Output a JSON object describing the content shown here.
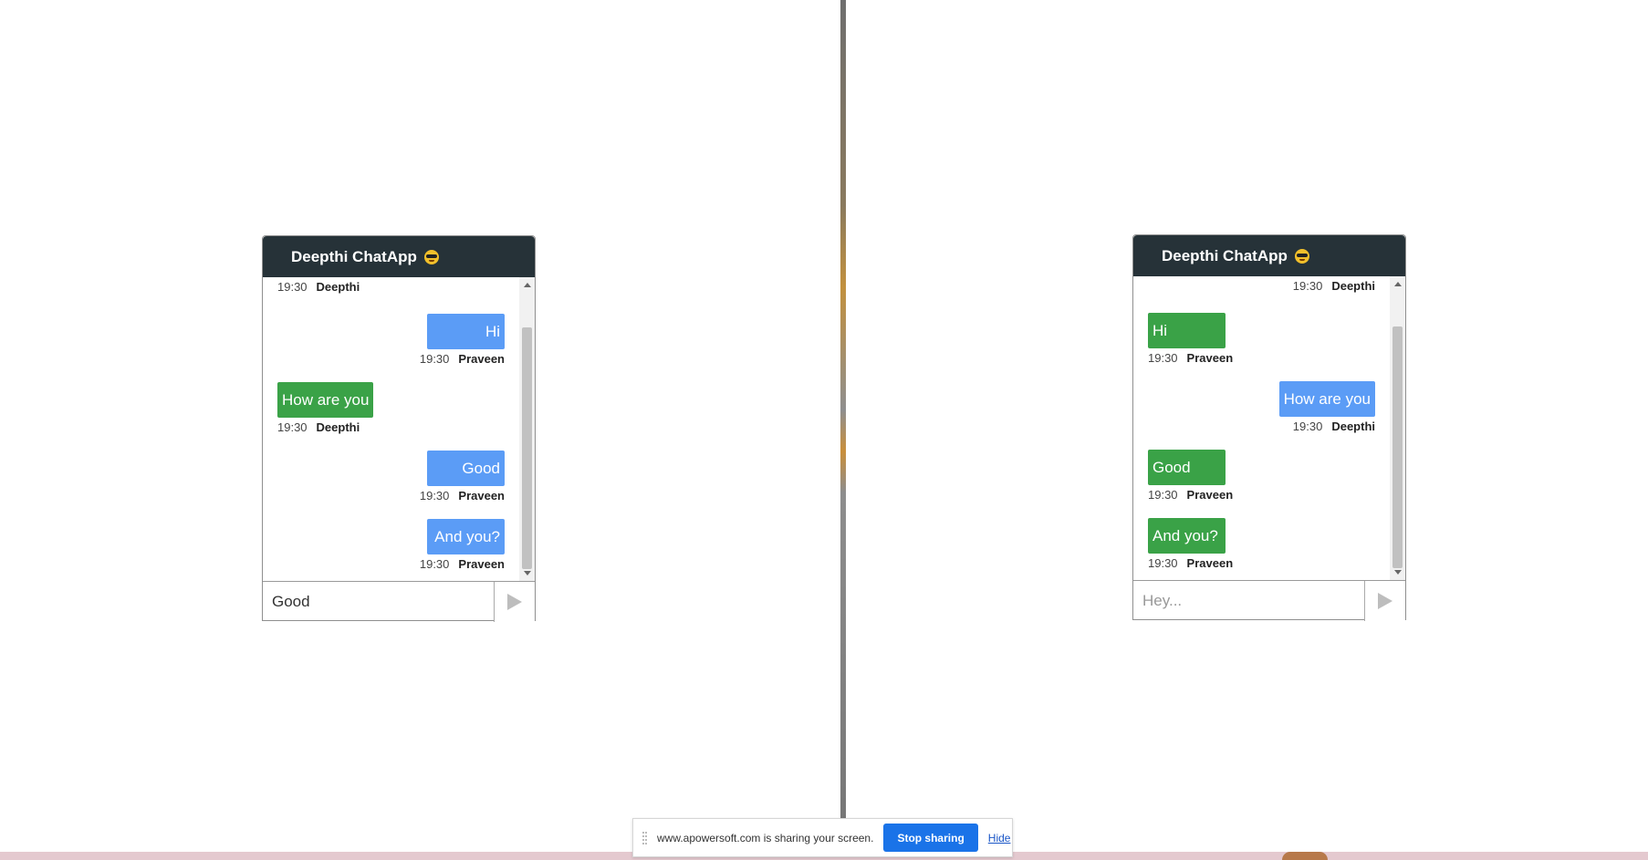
{
  "share_bar": {
    "message": "www.apowersoft.com is sharing your screen.",
    "stop_label": "Stop sharing",
    "hide_label": "Hide"
  },
  "chat_left": {
    "title": "Deepthi ChatApp",
    "input_value": "Good",
    "input_placeholder": "Hey...",
    "top_meta": {
      "time": "19:30",
      "name": "Deepthi"
    },
    "messages": [
      {
        "text": "Hi",
        "time": "19:30",
        "name": "Praveen",
        "side": "right",
        "color": "blue"
      },
      {
        "text": "How are you",
        "time": "19:30",
        "name": "Deepthi",
        "side": "left",
        "color": "green"
      },
      {
        "text": "Good",
        "time": "19:30",
        "name": "Praveen",
        "side": "right",
        "color": "blue"
      },
      {
        "text": "And you?",
        "time": "19:30",
        "name": "Praveen",
        "side": "right",
        "color": "blue"
      }
    ]
  },
  "chat_right": {
    "title": "Deepthi ChatApp",
    "input_value": "",
    "input_placeholder": "Hey...",
    "top_meta": {
      "time": "19:30",
      "name": "Deepthi"
    },
    "messages": [
      {
        "text": "Hi",
        "time": "19:30",
        "name": "Praveen",
        "side": "left",
        "color": "green"
      },
      {
        "text": "How are you",
        "time": "19:30",
        "name": "Deepthi",
        "side": "right",
        "color": "blue"
      },
      {
        "text": "Good",
        "time": "19:30",
        "name": "Praveen",
        "side": "left",
        "color": "green"
      },
      {
        "text": "And you?",
        "time": "19:30",
        "name": "Praveen",
        "side": "left",
        "color": "green"
      }
    ]
  },
  "colors": {
    "header_bg": "#263238",
    "sent_bubble": "#5b9cf6",
    "received_bubble": "#3aa247",
    "share_button": "#1a73e8"
  }
}
